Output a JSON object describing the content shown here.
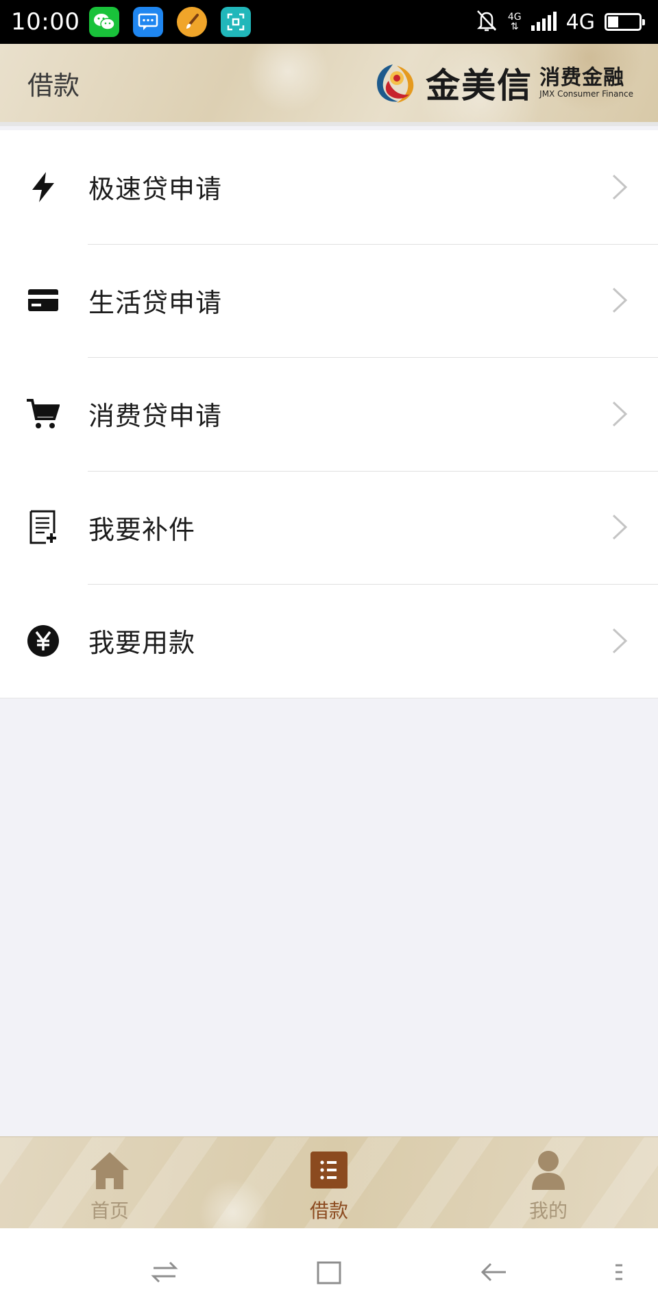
{
  "status_bar": {
    "time": "10:00",
    "apps": [
      "wechat-icon",
      "messages-icon",
      "paint-icon",
      "scanner-icon"
    ],
    "network_small": "4G",
    "network": "4G",
    "battery_level": 0.35
  },
  "header": {
    "title": "借款",
    "brand_name": "金美信",
    "brand_sub_cn": "消费金融",
    "brand_sub_en": "JMX Consumer Finance"
  },
  "menu": {
    "items": [
      {
        "label": "极速贷申请",
        "icon": "lightning-icon"
      },
      {
        "label": "生活贷申请",
        "icon": "credit-card-icon"
      },
      {
        "label": "消费贷申请",
        "icon": "shopping-cart-icon"
      },
      {
        "label": "我要补件",
        "icon": "document-add-icon"
      },
      {
        "label": "我要用款",
        "icon": "yuan-coin-icon"
      }
    ]
  },
  "tab_bar": {
    "tabs": [
      {
        "label": "首页",
        "icon": "home-icon",
        "active": false
      },
      {
        "label": "借款",
        "icon": "loan-list-icon",
        "active": true
      },
      {
        "label": "我的",
        "icon": "profile-icon",
        "active": false
      }
    ]
  },
  "colors": {
    "tab_active": "#8b4a1f",
    "tab_inactive": "#a9977a",
    "list_background": "#f2f2f7"
  }
}
